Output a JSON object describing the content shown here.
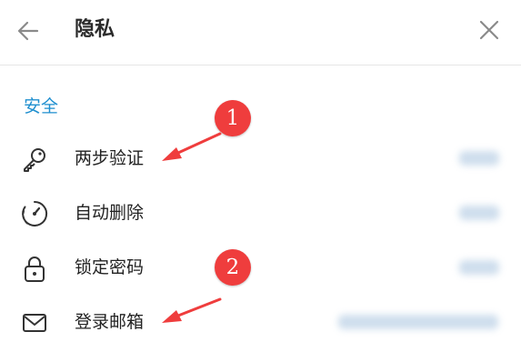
{
  "header": {
    "title": "隐私",
    "back_icon": "arrow-left-icon",
    "close_icon": "close-icon"
  },
  "section": {
    "title": "安全"
  },
  "rows": [
    {
      "label": "两步验证",
      "icon": "key-icon"
    },
    {
      "label": "自动删除",
      "icon": "timer-icon"
    },
    {
      "label": "锁定密码",
      "icon": "lock-icon"
    },
    {
      "label": "登录邮箱",
      "icon": "mail-icon"
    }
  ],
  "annotations": [
    {
      "number": "1"
    },
    {
      "number": "2"
    }
  ],
  "colors": {
    "accent": "#1f8fcf",
    "marker": "#ef3d3d"
  }
}
